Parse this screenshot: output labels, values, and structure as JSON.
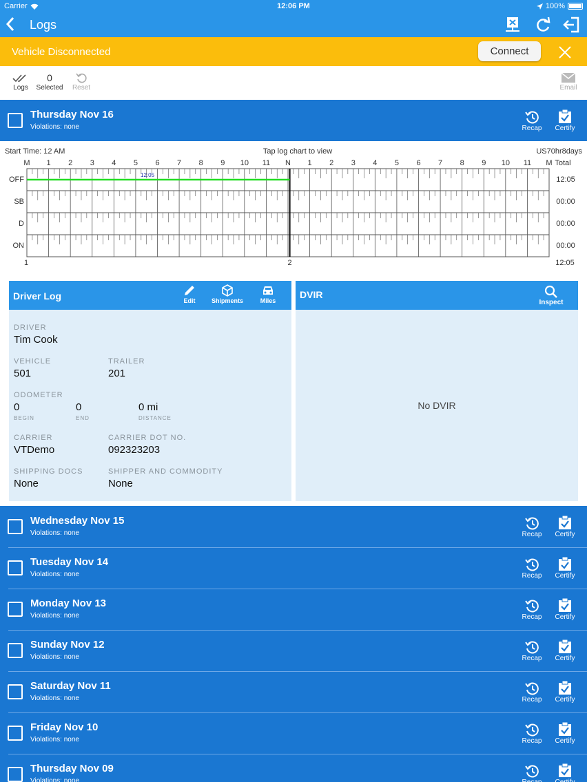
{
  "status_bar": {
    "carrier": "Carrier",
    "time": "12:06 PM",
    "battery": "100%"
  },
  "nav": {
    "title": "Logs"
  },
  "banner": {
    "message": "Vehicle Disconnected",
    "connect_label": "Connect"
  },
  "toolbar": {
    "logs_label": "Logs",
    "selected_count": "0",
    "selected_label": "Selected",
    "reset_label": "Reset",
    "email_label": "Email"
  },
  "current_day": {
    "name": "Thursday Nov 16",
    "violations": "Violations:  none",
    "recap_label": "Recap",
    "certify_label": "Certify"
  },
  "chart": {
    "start_time": "Start Time: 12 AM",
    "tap_hint": "Tap log chart to view",
    "ruleset": "US70hr8days",
    "hour_labels": [
      "M",
      "1",
      "2",
      "3",
      "4",
      "5",
      "6",
      "7",
      "8",
      "9",
      "10",
      "11",
      "N",
      "1",
      "2",
      "3",
      "4",
      "5",
      "6",
      "7",
      "8",
      "9",
      "10",
      "11",
      "M"
    ],
    "total_label": "Total",
    "rows": [
      {
        "label": "OFF",
        "total": "12:05"
      },
      {
        "label": "SB",
        "total": "00:00"
      },
      {
        "label": "D",
        "total": "00:00"
      },
      {
        "label": "ON",
        "total": "00:00"
      }
    ],
    "segment": {
      "status": "OFF",
      "start_hour": 0,
      "end_hour": 12.083,
      "label": "12:05"
    },
    "current_hour": 12.083,
    "bottom_left": "1",
    "bottom_mid": "2",
    "grand_total": "12:05",
    "colors": {
      "segment": "#22dd22",
      "grid": "#555555"
    }
  },
  "driver_log": {
    "title": "Driver Log",
    "edit_label": "Edit",
    "shipments_label": "Shipments",
    "miles_label": "Miles",
    "driver_label": "DRIVER",
    "driver": "Tim Cook",
    "vehicle_label": "VEHICLE",
    "vehicle": "501",
    "trailer_label": "TRAILER",
    "trailer": "201",
    "odometer_label": "ODOMETER",
    "odo_begin": "0",
    "odo_begin_label": "BEGIN",
    "odo_end": "0",
    "odo_end_label": "END",
    "odo_distance": "0 mi",
    "odo_distance_label": "DISTANCE",
    "carrier_label": "CARRIER",
    "carrier": "VTDemo",
    "dot_label": "CARRIER DOT NO.",
    "dot": "092323203",
    "shipping_docs_label": "SHIPPING DOCS",
    "shipping_docs": "None",
    "shipper_label": "SHIPPER AND COMMODITY",
    "shipper": "None"
  },
  "dvir": {
    "title": "DVIR",
    "inspect_label": "Inspect",
    "empty_text": "No DVIR"
  },
  "days": [
    {
      "name": "Wednesday Nov 15",
      "violations": "Violations:  none",
      "recap_label": "Recap",
      "certify_label": "Certify"
    },
    {
      "name": "Tuesday Nov 14",
      "violations": "Violations:  none",
      "recap_label": "Recap",
      "certify_label": "Certify"
    },
    {
      "name": "Monday Nov 13",
      "violations": "Violations:  none",
      "recap_label": "Recap",
      "certify_label": "Certify"
    },
    {
      "name": "Sunday Nov 12",
      "violations": "Violations:  none",
      "recap_label": "Recap",
      "certify_label": "Certify"
    },
    {
      "name": "Saturday Nov 11",
      "violations": "Violations:  none",
      "recap_label": "Recap",
      "certify_label": "Certify"
    },
    {
      "name": "Friday Nov 10",
      "violations": "Violations:  none",
      "recap_label": "Recap",
      "certify_label": "Certify"
    },
    {
      "name": "Thursday Nov 09",
      "violations": "Violations:  none",
      "recap_label": "Recap",
      "certify_label": "Certify"
    }
  ],
  "colors": {
    "primary": "#2a95e8",
    "day_row": "#1a77d2",
    "banner": "#fbbd0c",
    "card": "#e0eef9"
  }
}
